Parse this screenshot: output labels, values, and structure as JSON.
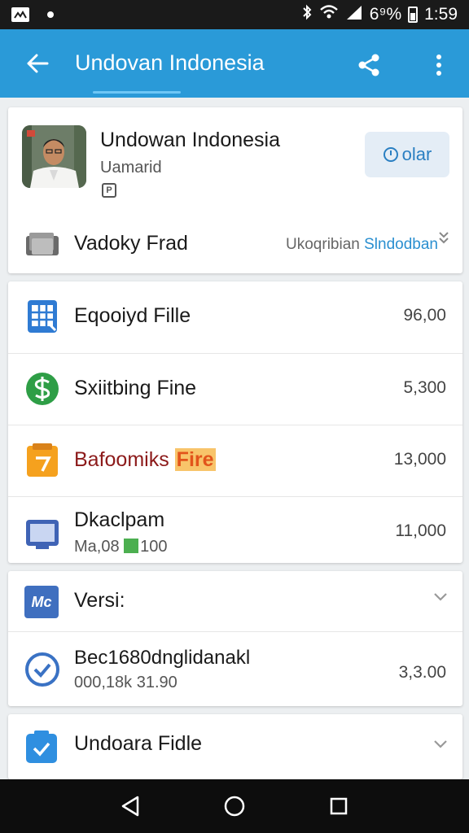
{
  "status_bar": {
    "battery": "6⁹%",
    "time": "1:59",
    "icons": [
      "app-notification-icon",
      "dot-icon",
      "bluetooth-icon",
      "wifi-icon",
      "signal-icon",
      "battery-icon"
    ]
  },
  "app_bar": {
    "title": "Undovan Indonesia",
    "color": "#2a9ad8",
    "icons": [
      "back-arrow-icon",
      "share-icon",
      "more-vert-icon"
    ]
  },
  "profile": {
    "name": "Undowan Indonesia",
    "subtitle": "Uamarid",
    "follow_label": "olar",
    "row": {
      "label": "Vadoky Frad",
      "value_part1": "Ukoqribian",
      "value_part2": "Slndodban"
    }
  },
  "files": [
    {
      "label": "Eqooiyd Fille",
      "value": "96,00",
      "icon": "spreadsheet-icon",
      "icon_color": "#2f7bd3"
    },
    {
      "label": "Sxiitbing Fine",
      "value": "5,300",
      "icon": "dollar-circle-icon",
      "icon_color": "#2e9e46"
    },
    {
      "label": "Bafoomiks",
      "label_highlight": "Fire",
      "value": "13,000",
      "icon": "clipboard-orange-icon",
      "icon_color": "#f5a11e"
    },
    {
      "label": "Dkaclpam",
      "sub_text": "Ma,08",
      "sub_value": "100",
      "value": "11,000",
      "icon": "monitor-icon",
      "icon_color": "#3f63b5"
    }
  ],
  "version": {
    "label": "Versi:",
    "icon_text": "Mc",
    "item": {
      "title": "Bec1680dnglidanakl",
      "subtitle": "000,18k 31.90",
      "value": "3,3.00"
    }
  },
  "bottom_item": {
    "label": "Undoara Fidle"
  }
}
